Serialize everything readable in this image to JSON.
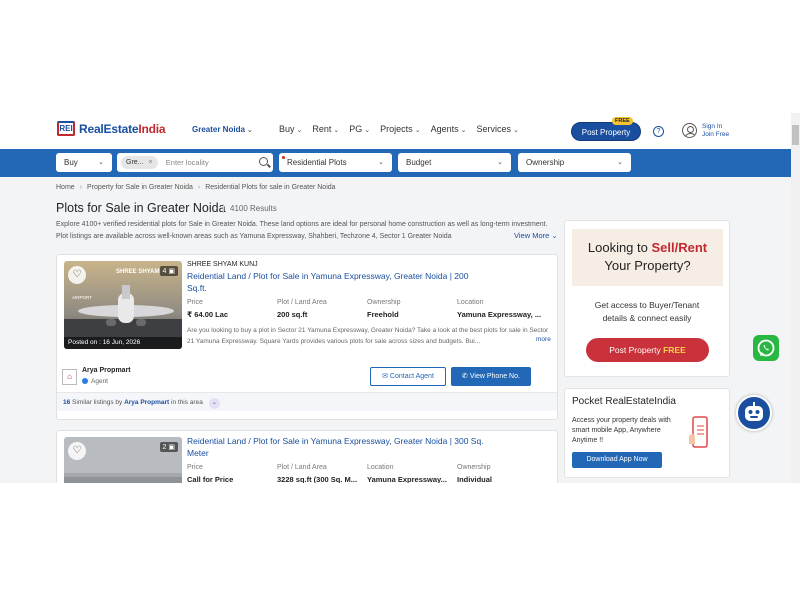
{
  "header": {
    "logo_mark": "REI",
    "logo_text_1": "RealEstate",
    "logo_text_2": "India",
    "city": "Greater Noida",
    "nav": [
      "Buy",
      "Rent",
      "PG",
      "Projects",
      "Agents",
      "Services"
    ],
    "post_property": "Post Property",
    "free_tag": "FREE",
    "signin": "Sign In",
    "joinfree": "Join Free"
  },
  "search": {
    "buy": "Buy",
    "chip": "Gre...",
    "chip_close": "×",
    "locality_placeholder": "Enter locality",
    "type": "Residential Plots",
    "budget": "Budget",
    "ownership": "Ownership"
  },
  "breadcrumb": [
    "Home",
    "Property for Sale in Greater Noida",
    "Residential Plots for sale in Greater Noida"
  ],
  "page": {
    "title": "Plots for Sale in Greater Noida",
    "results": "4100 Results",
    "intro": "Explore 4100+ verified residential plots for Sale in Greater Noida. These land options are ideal for personal home construction as well as long-term investment. Plot listings are available across well-known areas such as Yamuna Expressway, Shahberi, Techzone 4, Sector 1 Greater Noida",
    "view_more": "View More"
  },
  "listings": [
    {
      "project": "SHREE SHYAM KUNJ",
      "title": "Reidential Land / Plot for Sale in Yamuna Expressway, Greater Noida | 200 Sq.ft.",
      "image_count": "4",
      "posted": "Posted on : 16 Jun, 2026",
      "meta_keys": [
        "Price",
        "Plot / Land Area",
        "Ownership",
        "Location"
      ],
      "meta_vals": [
        "₹ 64.00 Lac",
        "200 sq.ft",
        "Freehold",
        "Yamuna Expressway, ..."
      ],
      "desc": "Are you looking to buy a plot in Sector 21 Yamuna Expressway, Greater Noida? Take a look at the best plots for sale in Sector 21 Yamuna Expressway. Square Yards provides various plots for sale across sizes and budgets. Bui...",
      "more": "more",
      "agent_name": "Arya Propmart",
      "agent_role": "Agent",
      "contact": "Contact Agent",
      "phone": "View Phone No.",
      "similar_count": "16",
      "similar_mid": " Similar listings by ",
      "similar_agent": "Arya Propmart",
      "similar_tail": " in this area"
    },
    {
      "title": "Reidential Land / Plot for Sale in Yamuna Expressway, Greater Noida | 300 Sq. Meter",
      "image_count": "2",
      "meta_keys": [
        "Price",
        "Plot / Land Area",
        "Location",
        "Ownership"
      ],
      "meta_vals": [
        "Call for Price",
        "3228 sq.ft (300 Sq. M...",
        "Yamuna Expressway...",
        "Individual"
      ]
    }
  ],
  "sidebar": {
    "promo_1": "Looking to ",
    "promo_red": "Sell/Rent",
    "promo_2": "Your Property?",
    "access": "Get access to Buyer/Tenant details & connect easily",
    "cta": "Post Property ",
    "cta_free": "FREE",
    "pocket_title": "Pocket RealEstateIndia",
    "pocket_text": "Access your property deals with smart mobile App, Anywhere Anytime !!",
    "download": "Download App Now"
  },
  "colors": {
    "brand_blue": "#1a4fa0",
    "search_blue": "#2368b6",
    "accent_red": "#c0292f"
  }
}
